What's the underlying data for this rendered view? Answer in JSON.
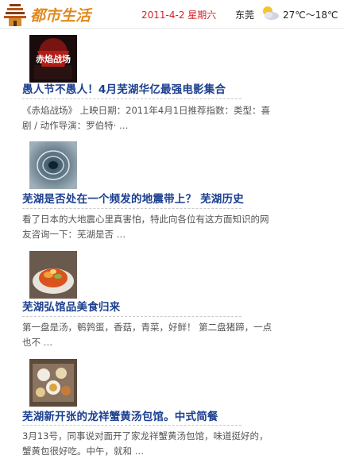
{
  "header": {
    "date": "2011-4-2 星期六",
    "city": "东莞",
    "weather_icon": "partly-cloudy-icon",
    "temperature": "27℃～18℃",
    "logo_icon": "pagoda-logo-icon",
    "logo_text": "都市生活"
  },
  "articles": [
    {
      "thumb_icon": "movie-poster-thumbnail",
      "title": "愚人节不愚人！4月芜湖华亿最强电影集合",
      "excerpt_line1": "《赤焰战场》 上映日期：2011年4月1日推荐指数：类型：喜",
      "excerpt_line2": "剧 / 动作导演：罗伯特· …",
      "thumb_text": "赤焰战场"
    },
    {
      "thumb_icon": "earthquake-photo-thumbnail",
      "title": "芜湖是否处在一个频发的地震带上？ 芜湖历史",
      "excerpt_line1": "看了日本的大地震心里真害怕，特此向各位有这方面知识的网",
      "excerpt_line2": "友咨询一下：芜湖是否 …"
    },
    {
      "thumb_icon": "food-photo-thumbnail",
      "title": "芜湖弘馆品美食归来",
      "excerpt_line1": "第一盘是汤，鹌鹑蛋，香菇，青菜，好鲜！ 第二盘猪蹄，一点",
      "excerpt_line2": "也不 …"
    },
    {
      "thumb_icon": "soup-dumpling-photo-thumbnail",
      "title": "芜湖新开张的龙祥蟹黄汤包馆。中式简餐",
      "excerpt_line1": "3月13号，同事说对面开了家龙祥蟹黄汤包馆，味道挺好的，",
      "excerpt_line2": "蟹黄包很好吃。中午，就和 …"
    }
  ],
  "colors": {
    "title": "#1b3f8f",
    "date": "#d2232a",
    "excerpt": "#555555"
  }
}
